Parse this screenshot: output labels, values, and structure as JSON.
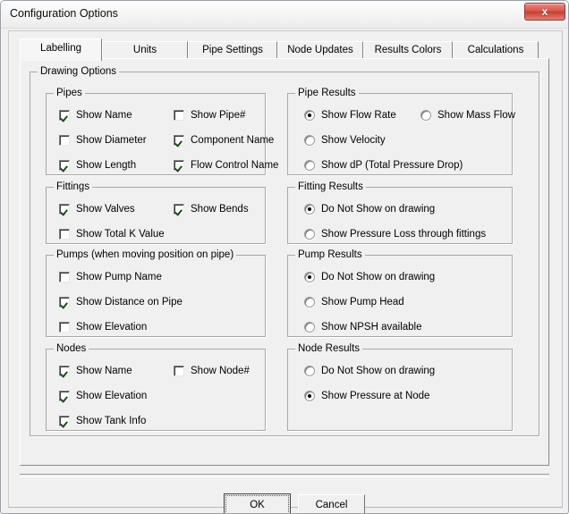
{
  "window": {
    "title": "Configuration Options",
    "close_label": "x"
  },
  "tabs": [
    {
      "label": "Labelling",
      "selected": true
    },
    {
      "label": "Units",
      "selected": false
    },
    {
      "label": "Pipe Settings",
      "selected": false
    },
    {
      "label": "Node Updates",
      "selected": false
    },
    {
      "label": "Results Colors",
      "selected": false
    },
    {
      "label": "Calculations",
      "selected": false
    }
  ],
  "drawing_options": {
    "legend": "Drawing Options",
    "groups": {
      "pipes": {
        "legend": "Pipes",
        "items": [
          {
            "label": "Show Name",
            "checked": true
          },
          {
            "label": "Show Pipe#",
            "checked": false
          },
          {
            "label": "Show Diameter",
            "checked": false
          },
          {
            "label": "Component Name",
            "checked": true
          },
          {
            "label": "Show Length",
            "checked": true
          },
          {
            "label": "Flow Control Name",
            "checked": true
          }
        ]
      },
      "pipe_results": {
        "legend": "Pipe Results",
        "items": [
          {
            "label": "Show Flow Rate",
            "selected": true
          },
          {
            "label": "Show Mass Flow",
            "selected": false
          },
          {
            "label": "Show Velocity",
            "selected": false
          },
          {
            "label": "Show dP (Total Pressure Drop)",
            "selected": false
          }
        ]
      },
      "fittings": {
        "legend": "Fittings",
        "items": [
          {
            "label": "Show Valves",
            "checked": true
          },
          {
            "label": "Show Bends",
            "checked": true
          },
          {
            "label": "Show Total K Value",
            "checked": false
          }
        ]
      },
      "fitting_results": {
        "legend": "Fitting Results",
        "items": [
          {
            "label": "Do Not Show on drawing",
            "selected": true
          },
          {
            "label": "Show Pressure Loss through fittings",
            "selected": false
          }
        ]
      },
      "pumps": {
        "legend": "Pumps (when moving position on pipe)",
        "items": [
          {
            "label": "Show Pump Name",
            "checked": false
          },
          {
            "label": "Show Distance on Pipe",
            "checked": true
          },
          {
            "label": "Show Elevation",
            "checked": false
          }
        ]
      },
      "pump_results": {
        "legend": "Pump Results",
        "items": [
          {
            "label": "Do Not Show on drawing",
            "selected": true
          },
          {
            "label": "Show Pump Head",
            "selected": false
          },
          {
            "label": "Show NPSH available",
            "selected": false
          }
        ]
      },
      "nodes": {
        "legend": "Nodes",
        "items": [
          {
            "label": "Show Name",
            "checked": true
          },
          {
            "label": "Show Node#",
            "checked": false
          },
          {
            "label": "Show Elevation",
            "checked": true
          },
          {
            "label": "Show Tank Info",
            "checked": true
          }
        ]
      },
      "node_results": {
        "legend": "Node Results",
        "items": [
          {
            "label": "Do Not Show on drawing",
            "selected": false
          },
          {
            "label": "Show Pressure at Node",
            "selected": true
          }
        ]
      }
    }
  },
  "footer": {
    "ok_label": "OK",
    "cancel_label": "Cancel"
  }
}
